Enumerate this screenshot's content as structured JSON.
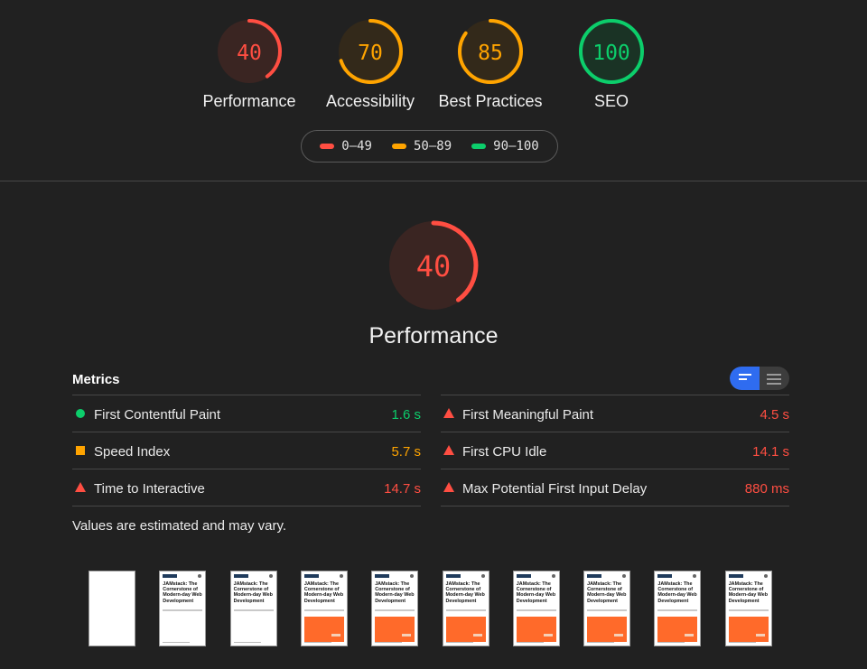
{
  "categories": [
    {
      "id": "performance",
      "score": "40",
      "label": "Performance",
      "color": "#ff4e42",
      "fill": "#3a2522",
      "fraction": 0.4
    },
    {
      "id": "accessibility",
      "score": "70",
      "label": "Accessibility",
      "color": "#ffa400",
      "fill": "#33291a",
      "fraction": 0.7
    },
    {
      "id": "best-practices",
      "score": "85",
      "label": "Best Practices",
      "color": "#ffa400",
      "fill": "#33291a",
      "fraction": 0.85
    },
    {
      "id": "seo",
      "score": "100",
      "label": "SEO",
      "color": "#0cce6b",
      "fill": "#1a3325",
      "fraction": 1.0
    }
  ],
  "legend": [
    {
      "range": "0–49",
      "color": "#ff4e42"
    },
    {
      "range": "50–89",
      "color": "#ffa400"
    },
    {
      "range": "90–100",
      "color": "#0cce6b"
    }
  ],
  "main": {
    "score": "40",
    "label": "Performance",
    "fraction": 0.4,
    "color": "#ff4e42",
    "fill": "#3a2522"
  },
  "metrics": {
    "title": "Metrics",
    "view_toggle": {
      "active": "compact",
      "icons": [
        "compact-list-icon",
        "expanded-list-icon"
      ]
    },
    "left": [
      {
        "name": "First Contentful Paint",
        "value": "1.6 s",
        "status": "pass",
        "icon": "circle",
        "color": "#0cce6b"
      },
      {
        "name": "Speed Index",
        "value": "5.7 s",
        "status": "average",
        "icon": "square",
        "color": "#ffa400"
      },
      {
        "name": "Time to Interactive",
        "value": "14.7 s",
        "status": "fail",
        "icon": "triangle",
        "color": "#ff4e42"
      }
    ],
    "right": [
      {
        "name": "First Meaningful Paint",
        "value": "4.5 s",
        "status": "fail",
        "icon": "triangle",
        "color": "#ff4e42"
      },
      {
        "name": "First CPU Idle",
        "value": "14.1 s",
        "status": "fail",
        "icon": "triangle",
        "color": "#ff4e42"
      },
      {
        "name": "Max Potential First Input Delay",
        "value": "880 ms",
        "status": "fail",
        "icon": "triangle",
        "color": "#ff4e42"
      }
    ],
    "note": "Values are estimated and may vary."
  },
  "filmstrip": {
    "frames": [
      {
        "blank": true,
        "hero": false
      },
      {
        "blank": false,
        "hero": false,
        "title": "JAMstack: The Cornerstone of Modern-day Web Development"
      },
      {
        "blank": false,
        "hero": false,
        "title": "JAMstack: The Cornerstone of Modern-day Web Development"
      },
      {
        "blank": false,
        "hero": true,
        "title": "JAMstack: The Cornerstone of Modern-day Web Development"
      },
      {
        "blank": false,
        "hero": true,
        "title": "JAMstack: The Cornerstone of Modern-day Web Development"
      },
      {
        "blank": false,
        "hero": true,
        "title": "JAMstack: The Cornerstone of Modern-day Web Development"
      },
      {
        "blank": false,
        "hero": true,
        "title": "JAMstack: The Cornerstone of Modern-day Web Development"
      },
      {
        "blank": false,
        "hero": true,
        "title": "JAMstack: The Cornerstone of Modern-day Web Development"
      },
      {
        "blank": false,
        "hero": true,
        "title": "JAMstack: The Cornerstone of Modern-day Web Development"
      },
      {
        "blank": false,
        "hero": true,
        "title": "JAMstack: The Cornerstone of Modern-day Web Development"
      }
    ]
  }
}
